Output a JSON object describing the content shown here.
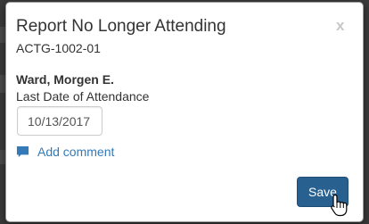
{
  "modal": {
    "title": "Report No Longer Attending",
    "close_label": "x",
    "subtitle": "ACTG-1002-01",
    "student_name": "Ward, Morgen E.",
    "date_label": "Last Date of Attendance",
    "date_value": "10/13/2017",
    "add_comment_label": "Add comment",
    "save_label": "Save"
  },
  "colors": {
    "primary": "#286090",
    "link": "#337ab7",
    "backdrop": "#3a3a3a"
  },
  "icons": {
    "comment": "comment-icon",
    "close": "close-icon",
    "cursor": "hand-pointer-icon"
  }
}
